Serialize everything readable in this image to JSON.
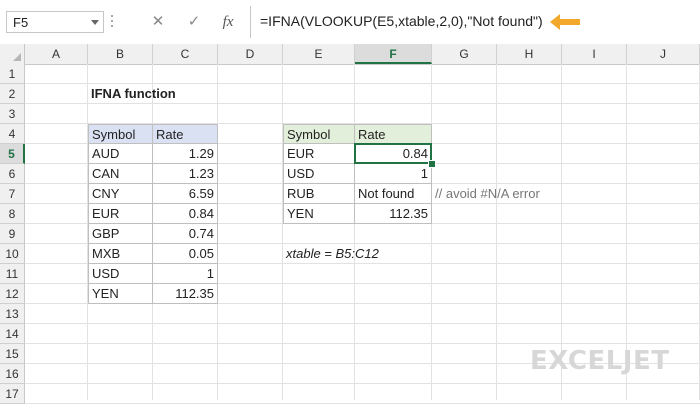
{
  "formula_bar": {
    "name_box": "F5",
    "cancel_icon": "✕",
    "enter_icon": "✓",
    "fx_label": "fx",
    "formula": "=IFNA(VLOOKUP(E5,xtable,2,0),\"Not found\")",
    "arrow_color": "#f2a92b"
  },
  "columns": [
    "A",
    "B",
    "C",
    "D",
    "E",
    "F",
    "G",
    "H",
    "I",
    "J"
  ],
  "rows": [
    "1",
    "2",
    "3",
    "4",
    "5",
    "6",
    "7",
    "8",
    "9",
    "10",
    "11",
    "12",
    "13",
    "14",
    "15",
    "16",
    "17"
  ],
  "active_cell": {
    "column": "F",
    "row": "5"
  },
  "sheet": {
    "title": "IFNA function",
    "lookup_table": {
      "headers": [
        "Symbol",
        "Rate"
      ],
      "rows": [
        [
          "AUD",
          "1.29"
        ],
        [
          "CAN",
          "1.23"
        ],
        [
          "CNY",
          "6.59"
        ],
        [
          "EUR",
          "0.84"
        ],
        [
          "GBP",
          "0.74"
        ],
        [
          "MXB",
          "0.05"
        ],
        [
          "USD",
          "1"
        ],
        [
          "YEN",
          "112.35"
        ]
      ]
    },
    "result_table": {
      "headers": [
        "Symbol",
        "Rate"
      ],
      "rows": [
        [
          "EUR",
          "0.84"
        ],
        [
          "USD",
          "1"
        ],
        [
          "RUB",
          "Not found"
        ],
        [
          "YEN",
          "112.35"
        ]
      ]
    },
    "comment": "// avoid #N/A error",
    "named_range_note": "xtable = B5:C12"
  },
  "colors": {
    "accent_green": "#217346",
    "lookup_header_fill": "#d9e1f2",
    "result_header_fill": "#e2efda"
  },
  "watermark": "EXCELJET"
}
